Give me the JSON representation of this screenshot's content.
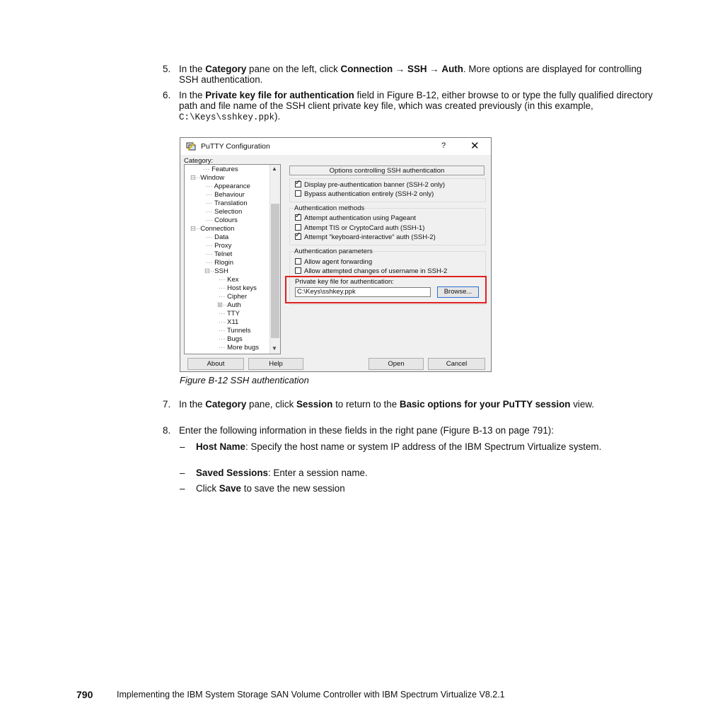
{
  "steps": {
    "s5": {
      "num": "5.",
      "a": "In the ",
      "b": "Category",
      "c": " pane on the left, click ",
      "d": "Connection",
      "e": " → ",
      "f": "SSH",
      "g": " → ",
      "h": "Auth",
      "i": ". More options are displayed for controlling SSH authentication."
    },
    "s6": {
      "num": "6.",
      "a": "In the ",
      "b": "Private key file for authentication",
      "c": " field in Figure B-12, either browse to or type the fully qualified directory path and file name of the SSH client private key file, which was created previously (in this example, ",
      "code": "C:\\Keys\\sshkey.ppk",
      "d": ")."
    },
    "s7": {
      "num": "7.",
      "a": "In the ",
      "b": "Category",
      "c": " pane, click ",
      "d": "Session",
      "e": " to return to the ",
      "f": "Basic options for your PuTTY session",
      "g": " view."
    },
    "s8": {
      "num": "8.",
      "a": "Enter the following information in these fields in the right pane (Figure B-13 on page 791):"
    }
  },
  "subitems": [
    {
      "dash": "–",
      "bold": "Host Name",
      "rest": ": Specify the host name or system IP address of the IBM Spectrum Virtualize system."
    },
    {
      "dash": "–",
      "bold": "Saved Sessions",
      "rest": ": Enter a session name."
    },
    {
      "dash": "–",
      "pre": "Click ",
      "bold": "Save",
      "rest": " to save the new session"
    }
  ],
  "putty": {
    "title": "PuTTY Configuration",
    "help": "?",
    "close": "✕",
    "category_label": "Category:",
    "tree": [
      "Features",
      "Window",
      "Appearance",
      "Behaviour",
      "Translation",
      "Selection",
      "Colours",
      "Connection",
      "Data",
      "Proxy",
      "Telnet",
      "Rlogin",
      "SSH",
      "Kex",
      "Host keys",
      "Cipher",
      "Auth",
      "TTY",
      "X11",
      "Tunnels",
      "Bugs",
      "More bugs"
    ],
    "panel_title": "Options controlling SSH authentication",
    "banner_opts": [
      {
        "label": "Display pre-authentication banner (SSH-2 only)",
        "checked": true
      },
      {
        "label": "Bypass authentication entirely (SSH-2 only)",
        "checked": false
      }
    ],
    "methods_label": "Authentication methods",
    "methods": [
      {
        "label": "Attempt authentication using Pageant",
        "checked": true
      },
      {
        "label": "Attempt TIS or CryptoCard auth (SSH-1)",
        "checked": false
      },
      {
        "label": "Attempt \"keyboard-interactive\" auth (SSH-2)",
        "checked": true
      }
    ],
    "params_label": "Authentication parameters",
    "params": [
      {
        "label": "Allow agent forwarding",
        "checked": false
      },
      {
        "label": "Allow attempted changes of username in SSH-2",
        "checked": false
      }
    ],
    "keyfile_label": "Private key file for authentication:",
    "keyfile_value": "C:\\Keys\\sshkey.ppk",
    "browse": "Browse...",
    "buttons": {
      "about": "About",
      "help": "Help",
      "open": "Open",
      "cancel": "Cancel"
    }
  },
  "caption": "Figure B-12   SSH authentication",
  "footer": {
    "page": "790",
    "text": "Implementing the IBM System Storage SAN Volume Controller with IBM Spectrum Virtualize V8.2.1"
  }
}
